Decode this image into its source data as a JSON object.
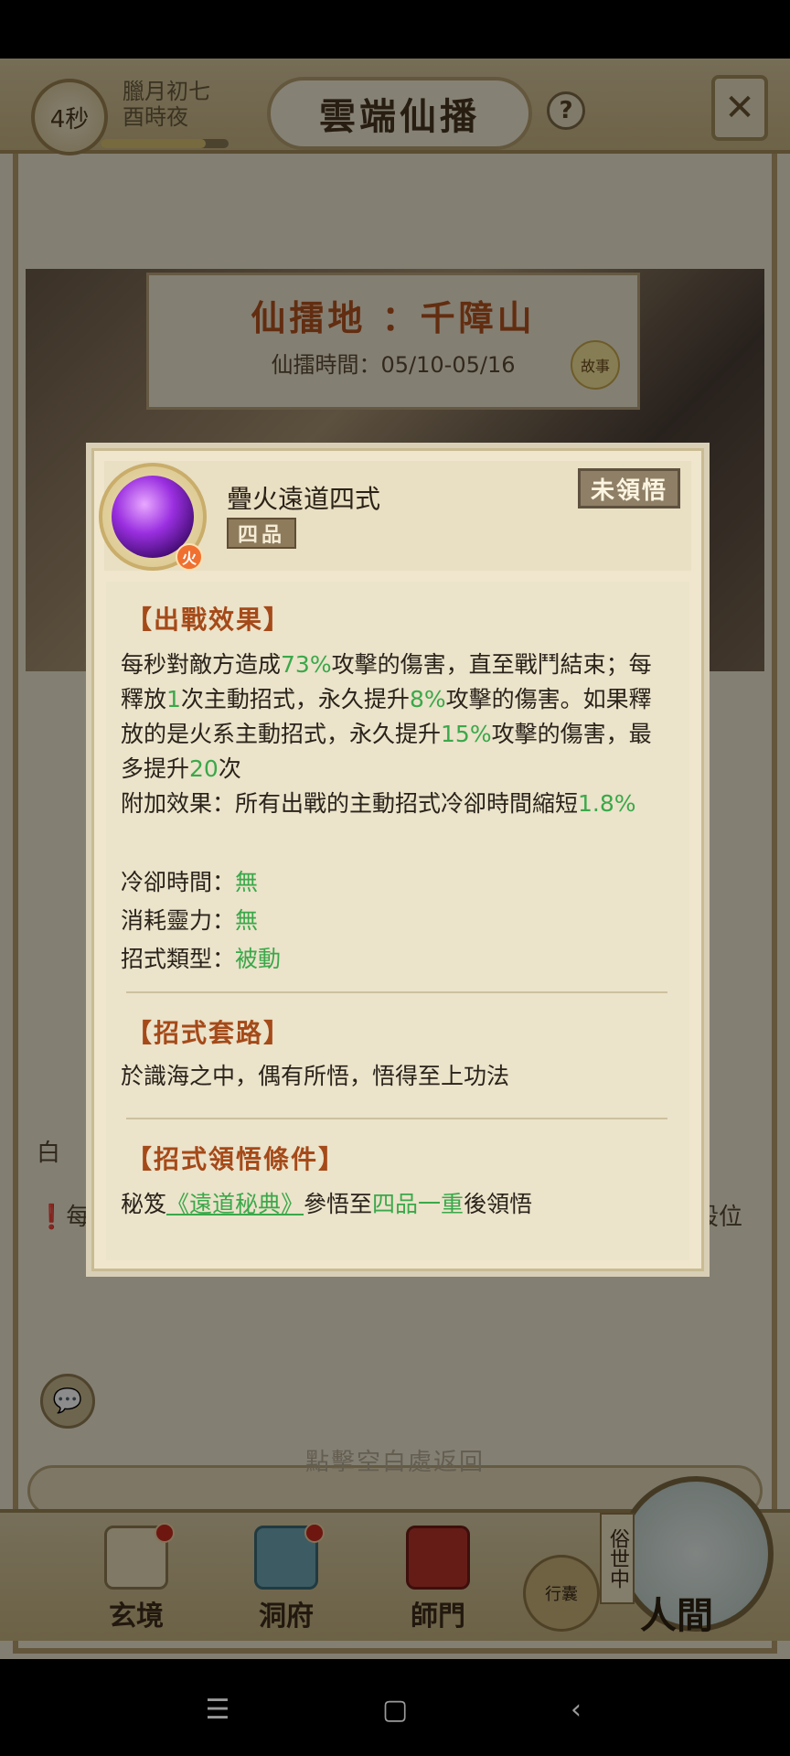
{
  "topbar": {
    "timer": "4秒",
    "date_line1": "臘月初七",
    "date_line2": "酉時夜",
    "title": "雲端仙播",
    "help": "?"
  },
  "banner": {
    "title": "仙擂地 ：千障山",
    "time": "仙擂時間：05/10-05/16",
    "story_tag": "故事"
  },
  "background": {
    "left_fragment": "白",
    "left_note_fragment": "每",
    "right_note_fragment": "段位",
    "hint": "點擊空白處返回"
  },
  "nav": {
    "items": [
      {
        "label": "玄境"
      },
      {
        "label": "洞府"
      },
      {
        "label": "師門"
      }
    ],
    "bag_label": "行囊",
    "world_tag": "俗世中",
    "world_label": "人間"
  },
  "modal": {
    "skill_name": "疊火遠道四式",
    "grade": "四品",
    "element": "火",
    "status": "未領悟",
    "sections": {
      "effect_title": "【出戰效果】",
      "effect": {
        "p1a": "每秒對敵方造成",
        "v1": "73%",
        "p1b": "攻擊的傷害，直至戰鬥結束；每釋放",
        "v2": "1",
        "p1c": "次主動招式，永久提升",
        "v3": "8%",
        "p1d": "攻擊的傷害。如果釋放的是火系主動招式，永久提升",
        "v4": "15%",
        "p1e": "攻擊的傷害，最多提升",
        "v5": "20",
        "p1f": "次"
      },
      "extra_prefix": "附加效果：所有出戰的主動招式冷卻時間縮短",
      "extra_value": "1.8%",
      "cooldown_label": "冷卻時間：",
      "cooldown_value": "無",
      "cost_label": "消耗靈力：",
      "cost_value": "無",
      "type_label": "招式類型：",
      "type_value": "被動",
      "routine_title": "【招式套路】",
      "routine_text": "於識海之中，偶有所悟，悟得至上功法",
      "cond_title": "【招式領悟條件】",
      "cond_prefix": "秘笈",
      "cond_book": "《遠道秘典》",
      "cond_mid": "參悟至",
      "cond_level": "四品一重",
      "cond_suffix": "後領悟"
    }
  }
}
